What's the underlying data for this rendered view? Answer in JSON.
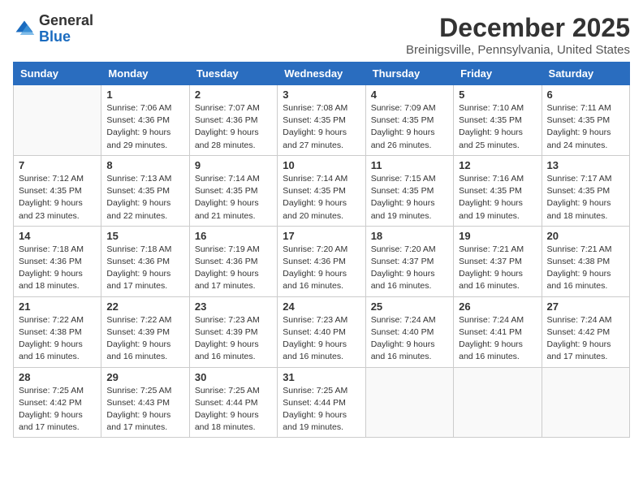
{
  "logo": {
    "general": "General",
    "blue": "Blue"
  },
  "title": "December 2025",
  "subtitle": "Breinigsville, Pennsylvania, United States",
  "days_of_week": [
    "Sunday",
    "Monday",
    "Tuesday",
    "Wednesday",
    "Thursday",
    "Friday",
    "Saturday"
  ],
  "weeks": [
    [
      {
        "num": "",
        "sunrise": "",
        "sunset": "",
        "daylight": ""
      },
      {
        "num": "1",
        "sunrise": "Sunrise: 7:06 AM",
        "sunset": "Sunset: 4:36 PM",
        "daylight": "Daylight: 9 hours and 29 minutes."
      },
      {
        "num": "2",
        "sunrise": "Sunrise: 7:07 AM",
        "sunset": "Sunset: 4:36 PM",
        "daylight": "Daylight: 9 hours and 28 minutes."
      },
      {
        "num": "3",
        "sunrise": "Sunrise: 7:08 AM",
        "sunset": "Sunset: 4:35 PM",
        "daylight": "Daylight: 9 hours and 27 minutes."
      },
      {
        "num": "4",
        "sunrise": "Sunrise: 7:09 AM",
        "sunset": "Sunset: 4:35 PM",
        "daylight": "Daylight: 9 hours and 26 minutes."
      },
      {
        "num": "5",
        "sunrise": "Sunrise: 7:10 AM",
        "sunset": "Sunset: 4:35 PM",
        "daylight": "Daylight: 9 hours and 25 minutes."
      },
      {
        "num": "6",
        "sunrise": "Sunrise: 7:11 AM",
        "sunset": "Sunset: 4:35 PM",
        "daylight": "Daylight: 9 hours and 24 minutes."
      }
    ],
    [
      {
        "num": "7",
        "sunrise": "Sunrise: 7:12 AM",
        "sunset": "Sunset: 4:35 PM",
        "daylight": "Daylight: 9 hours and 23 minutes."
      },
      {
        "num": "8",
        "sunrise": "Sunrise: 7:13 AM",
        "sunset": "Sunset: 4:35 PM",
        "daylight": "Daylight: 9 hours and 22 minutes."
      },
      {
        "num": "9",
        "sunrise": "Sunrise: 7:14 AM",
        "sunset": "Sunset: 4:35 PM",
        "daylight": "Daylight: 9 hours and 21 minutes."
      },
      {
        "num": "10",
        "sunrise": "Sunrise: 7:14 AM",
        "sunset": "Sunset: 4:35 PM",
        "daylight": "Daylight: 9 hours and 20 minutes."
      },
      {
        "num": "11",
        "sunrise": "Sunrise: 7:15 AM",
        "sunset": "Sunset: 4:35 PM",
        "daylight": "Daylight: 9 hours and 19 minutes."
      },
      {
        "num": "12",
        "sunrise": "Sunrise: 7:16 AM",
        "sunset": "Sunset: 4:35 PM",
        "daylight": "Daylight: 9 hours and 19 minutes."
      },
      {
        "num": "13",
        "sunrise": "Sunrise: 7:17 AM",
        "sunset": "Sunset: 4:35 PM",
        "daylight": "Daylight: 9 hours and 18 minutes."
      }
    ],
    [
      {
        "num": "14",
        "sunrise": "Sunrise: 7:18 AM",
        "sunset": "Sunset: 4:36 PM",
        "daylight": "Daylight: 9 hours and 18 minutes."
      },
      {
        "num": "15",
        "sunrise": "Sunrise: 7:18 AM",
        "sunset": "Sunset: 4:36 PM",
        "daylight": "Daylight: 9 hours and 17 minutes."
      },
      {
        "num": "16",
        "sunrise": "Sunrise: 7:19 AM",
        "sunset": "Sunset: 4:36 PM",
        "daylight": "Daylight: 9 hours and 17 minutes."
      },
      {
        "num": "17",
        "sunrise": "Sunrise: 7:20 AM",
        "sunset": "Sunset: 4:36 PM",
        "daylight": "Daylight: 9 hours and 16 minutes."
      },
      {
        "num": "18",
        "sunrise": "Sunrise: 7:20 AM",
        "sunset": "Sunset: 4:37 PM",
        "daylight": "Daylight: 9 hours and 16 minutes."
      },
      {
        "num": "19",
        "sunrise": "Sunrise: 7:21 AM",
        "sunset": "Sunset: 4:37 PM",
        "daylight": "Daylight: 9 hours and 16 minutes."
      },
      {
        "num": "20",
        "sunrise": "Sunrise: 7:21 AM",
        "sunset": "Sunset: 4:38 PM",
        "daylight": "Daylight: 9 hours and 16 minutes."
      }
    ],
    [
      {
        "num": "21",
        "sunrise": "Sunrise: 7:22 AM",
        "sunset": "Sunset: 4:38 PM",
        "daylight": "Daylight: 9 hours and 16 minutes."
      },
      {
        "num": "22",
        "sunrise": "Sunrise: 7:22 AM",
        "sunset": "Sunset: 4:39 PM",
        "daylight": "Daylight: 9 hours and 16 minutes."
      },
      {
        "num": "23",
        "sunrise": "Sunrise: 7:23 AM",
        "sunset": "Sunset: 4:39 PM",
        "daylight": "Daylight: 9 hours and 16 minutes."
      },
      {
        "num": "24",
        "sunrise": "Sunrise: 7:23 AM",
        "sunset": "Sunset: 4:40 PM",
        "daylight": "Daylight: 9 hours and 16 minutes."
      },
      {
        "num": "25",
        "sunrise": "Sunrise: 7:24 AM",
        "sunset": "Sunset: 4:40 PM",
        "daylight": "Daylight: 9 hours and 16 minutes."
      },
      {
        "num": "26",
        "sunrise": "Sunrise: 7:24 AM",
        "sunset": "Sunset: 4:41 PM",
        "daylight": "Daylight: 9 hours and 16 minutes."
      },
      {
        "num": "27",
        "sunrise": "Sunrise: 7:24 AM",
        "sunset": "Sunset: 4:42 PM",
        "daylight": "Daylight: 9 hours and 17 minutes."
      }
    ],
    [
      {
        "num": "28",
        "sunrise": "Sunrise: 7:25 AM",
        "sunset": "Sunset: 4:42 PM",
        "daylight": "Daylight: 9 hours and 17 minutes."
      },
      {
        "num": "29",
        "sunrise": "Sunrise: 7:25 AM",
        "sunset": "Sunset: 4:43 PM",
        "daylight": "Daylight: 9 hours and 17 minutes."
      },
      {
        "num": "30",
        "sunrise": "Sunrise: 7:25 AM",
        "sunset": "Sunset: 4:44 PM",
        "daylight": "Daylight: 9 hours and 18 minutes."
      },
      {
        "num": "31",
        "sunrise": "Sunrise: 7:25 AM",
        "sunset": "Sunset: 4:44 PM",
        "daylight": "Daylight: 9 hours and 19 minutes."
      },
      {
        "num": "",
        "sunrise": "",
        "sunset": "",
        "daylight": ""
      },
      {
        "num": "",
        "sunrise": "",
        "sunset": "",
        "daylight": ""
      },
      {
        "num": "",
        "sunrise": "",
        "sunset": "",
        "daylight": ""
      }
    ]
  ]
}
